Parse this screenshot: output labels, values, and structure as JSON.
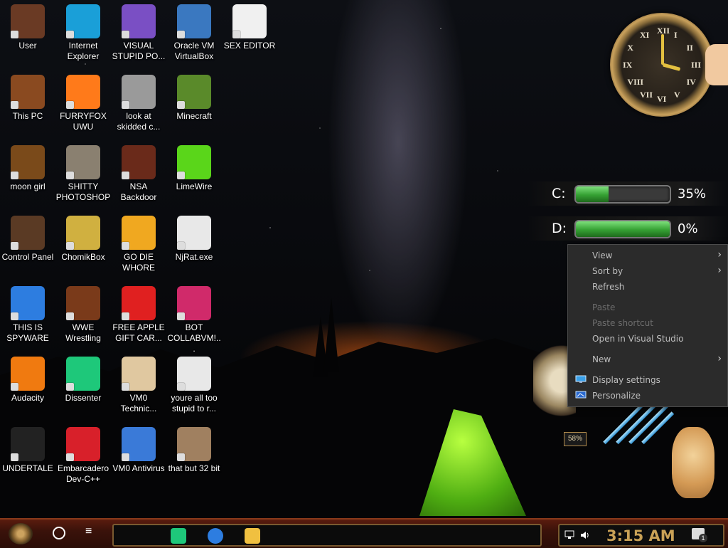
{
  "desktop_icons": [
    {
      "label": "User",
      "icon": "steampunk-user-icon",
      "color": "#6a3a24"
    },
    {
      "label": "This PC",
      "icon": "steampunk-pc-icon",
      "color": "#8a4a20"
    },
    {
      "label": "moon girl",
      "icon": "crate-icon",
      "color": "#7a4a1a"
    },
    {
      "label": "Control Panel",
      "icon": "lightbulb-icon",
      "color": "#5a3a24"
    },
    {
      "label": "THIS IS SPYWARE",
      "icon": "chrome-icon",
      "color": "#2d7de0"
    },
    {
      "label": "Audacity",
      "icon": "audacity-icon",
      "color": "#f07a10"
    },
    {
      "label": "UNDERTALE",
      "icon": "unity-icon",
      "color": "#222222"
    },
    {
      "label": "Internet Explorer",
      "icon": "edge-icon",
      "color": "#1a9fd8"
    },
    {
      "label": "FURRYFOX UWU",
      "icon": "firefox-icon",
      "color": "#ff7a1a"
    },
    {
      "label": "SHITTY PHOTOSHOP",
      "icon": "gimp-icon",
      "color": "#8a8070"
    },
    {
      "label": "ChomikBox",
      "icon": "chomikbox-icon",
      "color": "#d0b040"
    },
    {
      "label": "WWE Wrestling",
      "icon": "steampunk-oven-icon",
      "color": "#7a3a1a"
    },
    {
      "label": "Dissenter",
      "icon": "dissenter-icon",
      "color": "#1ec87a"
    },
    {
      "label": "Embarcadero Dev-C++",
      "icon": "devcpp-icon",
      "color": "#d8202a"
    },
    {
      "label": "VISUAL STUPID PO...",
      "icon": "visual-studio-icon",
      "color": "#7a4fc4"
    },
    {
      "label": "look at skidded c...",
      "icon": "windows-stack-icon",
      "color": "#9a9a9a"
    },
    {
      "label": "NSA Backdoor",
      "icon": "steampunk-frame-icon",
      "color": "#6a2a1a"
    },
    {
      "label": "GO DIE WHORE",
      "icon": "de-icon",
      "color": "#f0a820"
    },
    {
      "label": "FREE APPLE GIFT CAR...",
      "icon": "apple-icon",
      "color": "#e02020"
    },
    {
      "label": "VM0 Technic...",
      "icon": "technician-icon",
      "color": "#e0c8a0"
    },
    {
      "label": "VM0 Antivirus",
      "icon": "shield-icon",
      "color": "#3a7ad8"
    },
    {
      "label": "Oracle VM VirtualBox",
      "icon": "virtualbox-icon",
      "color": "#3a78c0"
    },
    {
      "label": "Minecraft",
      "icon": "minecraft-icon",
      "color": "#5a8a2a"
    },
    {
      "label": "LimeWire",
      "icon": "limewire-icon",
      "color": "#5ad61a"
    },
    {
      "label": "NjRat.exe",
      "icon": "skull-icon",
      "color": "#e8e8e8"
    },
    {
      "label": "BOT COLLABVM!...",
      "icon": "monitor-icon",
      "color": "#d02a6a"
    },
    {
      "label": "youre all too stupid to r...",
      "icon": "portrait-icon",
      "color": "#e8e8e8"
    },
    {
      "label": "that but 32 bit",
      "icon": "painting-icon",
      "color": "#a08060"
    },
    {
      "label": "SEX EDITOR",
      "icon": "hxd-icon",
      "color": "#f0f0f0"
    }
  ],
  "clock": {
    "numerals": [
      "XII",
      "I",
      "II",
      "III",
      "IV",
      "V",
      "VI",
      "VII",
      "VIII",
      "IX",
      "X",
      "XI"
    ]
  },
  "drives": [
    {
      "letter": "C:",
      "percent_label": "35%",
      "fill": 0.35
    },
    {
      "letter": "D:",
      "percent_label": "0%",
      "fill": 1.0
    }
  ],
  "gauge": {
    "label": "58%"
  },
  "context_menu": {
    "items": [
      {
        "label": "View",
        "submenu": true,
        "disabled": false
      },
      {
        "label": "Sort by",
        "submenu": true,
        "disabled": false
      },
      {
        "label": "Refresh",
        "submenu": false,
        "disabled": false
      },
      {
        "label": "Paste",
        "submenu": false,
        "disabled": true
      },
      {
        "label": "Paste shortcut",
        "submenu": false,
        "disabled": true
      },
      {
        "label": "Open in Visual Studio",
        "submenu": false,
        "disabled": false
      },
      {
        "label": "New",
        "submenu": true,
        "disabled": false
      },
      {
        "label": "Display settings",
        "submenu": false,
        "disabled": false,
        "icon": "display-icon"
      },
      {
        "label": "Personalize",
        "submenu": false,
        "disabled": false,
        "icon": "personalize-icon"
      }
    ]
  },
  "taskbar": {
    "time": "3:15 AM",
    "pinned": [
      {
        "name": "dissenter-taskbar-icon",
        "color": "#1ec87a"
      },
      {
        "name": "chrome-taskbar-icon",
        "color": "#2d7de0"
      },
      {
        "name": "file-explorer-taskbar-icon",
        "color": "#f0c040"
      }
    ],
    "notification_count": "1"
  },
  "colors": {
    "accent": "#c9a156",
    "menu_bg": "#2b2b2b",
    "taskbar": "#3a120a"
  }
}
